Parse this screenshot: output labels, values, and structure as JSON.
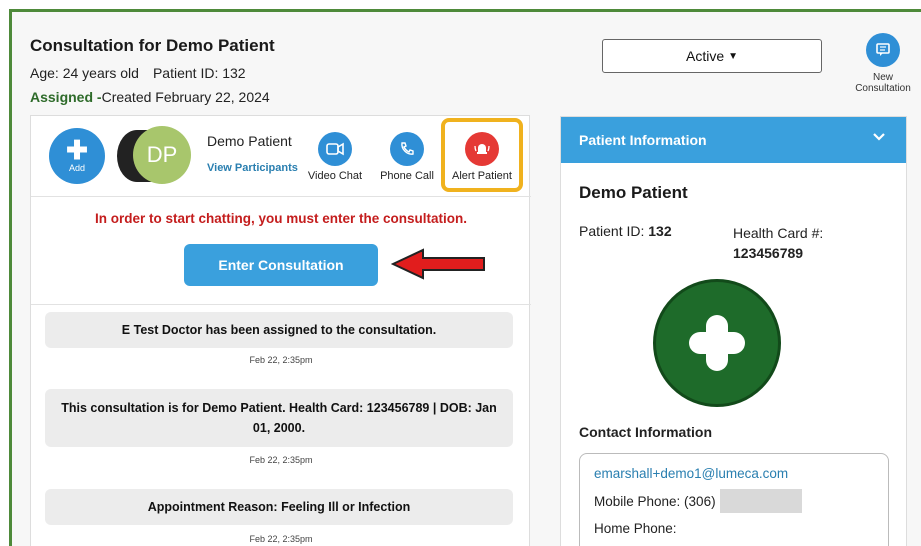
{
  "header": {
    "title": "Consultation for Demo Patient",
    "age": "Age: 24 years old",
    "patient_id": "Patient ID: 132",
    "assigned_label": "Assigned -",
    "created": "Created February 22, 2024"
  },
  "status": {
    "value": "Active"
  },
  "new_consultation": {
    "label_line1": "New",
    "label_line2": "Consultation",
    "icon": "chat-icon"
  },
  "toolbar": {
    "add_label": "Add",
    "avatar_initials": "DP",
    "patient_name": "Demo Patient",
    "view_participants": "View Participants",
    "video_chat": "Video Chat",
    "phone_call": "Phone Call",
    "alert_patient": "Alert Patient"
  },
  "chat": {
    "warning": "In order to start chatting, you must enter the consultation.",
    "enter_button": "Enter Consultation",
    "messages": [
      {
        "text": "E Test Doctor has been assigned to the consultation.",
        "time": "Feb 22, 2:35pm"
      },
      {
        "text": "This consultation is for Demo Patient. Health Card: 123456789 | DOB: Jan 01, 2000.",
        "time": "Feb 22, 2:35pm"
      },
      {
        "text": "Appointment Reason: Feeling Ill or Infection",
        "time": "Feb 22, 2:35pm"
      }
    ]
  },
  "patient_info": {
    "heading": "Patient Information",
    "name": "Demo Patient",
    "id_label": "Patient ID:",
    "id_value": "132",
    "health_card_label": "Health Card #:",
    "health_card_value": "123456789",
    "contact_heading": "Contact Information",
    "email": "emarshall+demo1@lumeca.com",
    "mobile_label": "Mobile Phone: (306)",
    "home_label": "Home Phone:"
  },
  "colors": {
    "primary": "#3aa0dd",
    "alert": "#e53935",
    "highlight": "#f0b21e",
    "brand_green": "#1e6b2a",
    "warning_text": "#c41d1d"
  }
}
